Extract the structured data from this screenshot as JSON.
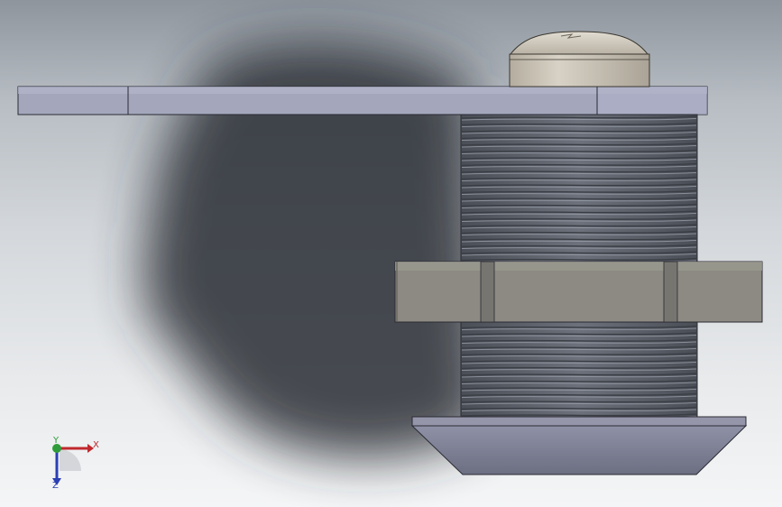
{
  "viewport": {
    "background_top": "#8e959d",
    "background_bottom": "#f4f5f6"
  },
  "model": {
    "parts": [
      "cam-plate",
      "dome-head-screw",
      "threaded-body",
      "hex-nut",
      "tapered-flange"
    ],
    "colors": {
      "plate": "#a4a7bc",
      "screw": "#c9c3b6",
      "thread_dark": "#3a3d44",
      "thread_light": "#9ea3ad",
      "nut": "#8c8a83",
      "flange": "#7e8096",
      "shadow": "#2b2f35"
    }
  },
  "triad": {
    "x_label": "X",
    "y_label": "Y",
    "z_label": "Z",
    "x_color": "#c0282d",
    "y_color": "#2e9c3a",
    "z_color": "#2b3fb3"
  }
}
